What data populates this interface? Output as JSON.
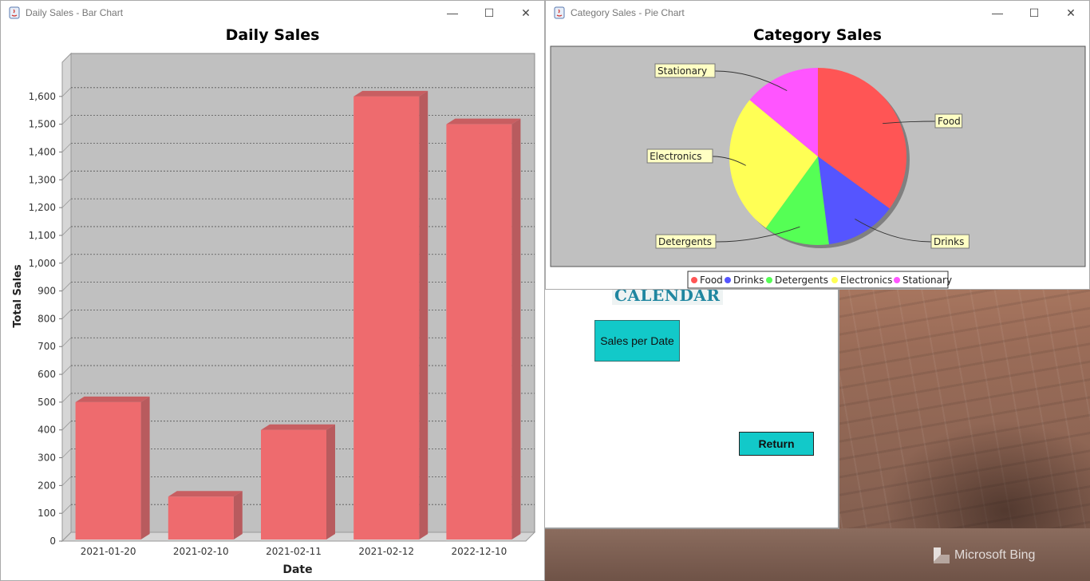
{
  "desktop": {
    "watermark": "Microsoft Bing"
  },
  "calendar_window": {
    "title": "CALENDAR",
    "sales_per_date_label": "Sales per Date",
    "return_label": "Return"
  },
  "bar_window": {
    "title": "Daily Sales - Bar Chart",
    "controls": {
      "minimize": "—",
      "maximize": "☐",
      "close": "✕"
    }
  },
  "pie_window": {
    "title": "Category Sales - Pie Chart",
    "controls": {
      "minimize": "—",
      "maximize": "☐",
      "close": "✕"
    }
  },
  "colors": {
    "bar": "#ee6b6e",
    "plot_bg": "#c0c0c0",
    "accent_teal": "#12c9c9"
  },
  "chart_data": [
    {
      "type": "bar",
      "title": "Daily Sales",
      "xlabel": "Date",
      "ylabel": "Total Sales",
      "categories": [
        "2021-01-20",
        "2021-02-10",
        "2021-02-11",
        "2021-02-12",
        "2022-12-10"
      ],
      "values": [
        500,
        160,
        400,
        1600,
        1500
      ],
      "ylim": [
        0,
        1700
      ],
      "yticks": [
        0,
        100,
        200,
        300,
        400,
        500,
        600,
        700,
        800,
        900,
        1000,
        1100,
        1200,
        1300,
        1400,
        1500,
        1600
      ],
      "ytick_labels": [
        "0",
        "100",
        "200",
        "300",
        "400",
        "500",
        "600",
        "700",
        "800",
        "900",
        "1,000",
        "1,100",
        "1,200",
        "1,300",
        "1,400",
        "1,500",
        "1,600"
      ],
      "grid": true,
      "style": "3d",
      "color": "#ee6b6e"
    },
    {
      "type": "pie",
      "title": "Category Sales",
      "labels": [
        "Food",
        "Drinks",
        "Detergents",
        "Electronics",
        "Stationary"
      ],
      "values": [
        35,
        13,
        12,
        26,
        14
      ],
      "colors": [
        "#ff5555",
        "#5555ff",
        "#55ff55",
        "#ffff55",
        "#ff55ff"
      ],
      "legend": "bottom",
      "legend_labels": [
        "Food",
        "Drinks",
        "Detergents",
        "Electronics",
        "Stationary"
      ]
    }
  ]
}
